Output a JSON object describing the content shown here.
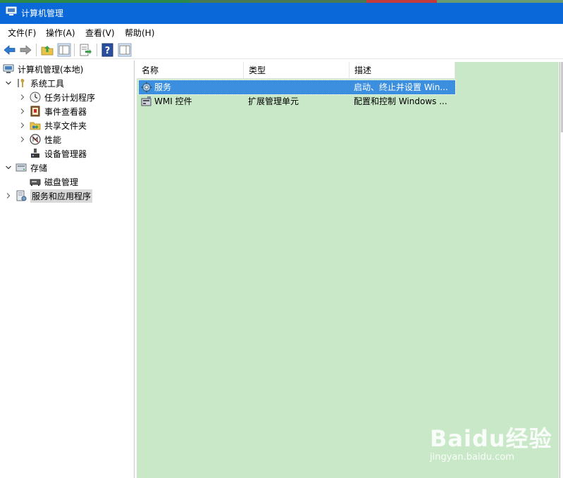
{
  "window": {
    "title": "计算机管理",
    "accent_color": "#0a68d8"
  },
  "menu": {
    "items": [
      "文件(F)",
      "操作(A)",
      "查看(V)",
      "帮助(H)"
    ]
  },
  "toolbar": {
    "icons": [
      "back-arrow-icon",
      "forward-arrow-icon",
      "up-folder-icon",
      "show-hide-tree-icon",
      "export-list-icon",
      "help-icon",
      "action-pane-icon"
    ]
  },
  "tree": {
    "items": [
      {
        "label": "计算机管理(本地)",
        "icon": "computer-management-icon"
      },
      {
        "label": "系统工具",
        "icon": "system-tools-icon",
        "state": "expanded"
      },
      {
        "label": "任务计划程序",
        "icon": "task-scheduler-icon",
        "state": "collapsed"
      },
      {
        "label": "事件查看器",
        "icon": "event-viewer-icon",
        "state": "collapsed"
      },
      {
        "label": "共享文件夹",
        "icon": "shared-folders-icon",
        "state": "collapsed"
      },
      {
        "label": "性能",
        "icon": "performance-icon",
        "state": "collapsed"
      },
      {
        "label": "设备管理器",
        "icon": "device-manager-icon"
      },
      {
        "label": "存储",
        "icon": "storage-icon",
        "state": "expanded"
      },
      {
        "label": "磁盘管理",
        "icon": "disk-management-icon"
      },
      {
        "label": "服务和应用程序",
        "icon": "services-applications-icon",
        "state": "collapsed",
        "selected": true
      }
    ]
  },
  "list": {
    "columns": [
      "名称",
      "类型",
      "描述"
    ],
    "rows": [
      {
        "name": "服务",
        "type": "",
        "description": "启动、终止并设置 Win...",
        "icon": "services-gear-icon",
        "selected": true
      },
      {
        "name": "WMI 控件",
        "type": "扩展管理单元",
        "description": "配置和控制 Windows ...",
        "icon": "wmi-control-icon"
      }
    ],
    "background_color": "#c8e8c8",
    "selection_color": "#3c8fde"
  },
  "watermark": {
    "brand": "Baidu经验",
    "url": "jingyan.baidu.com"
  }
}
